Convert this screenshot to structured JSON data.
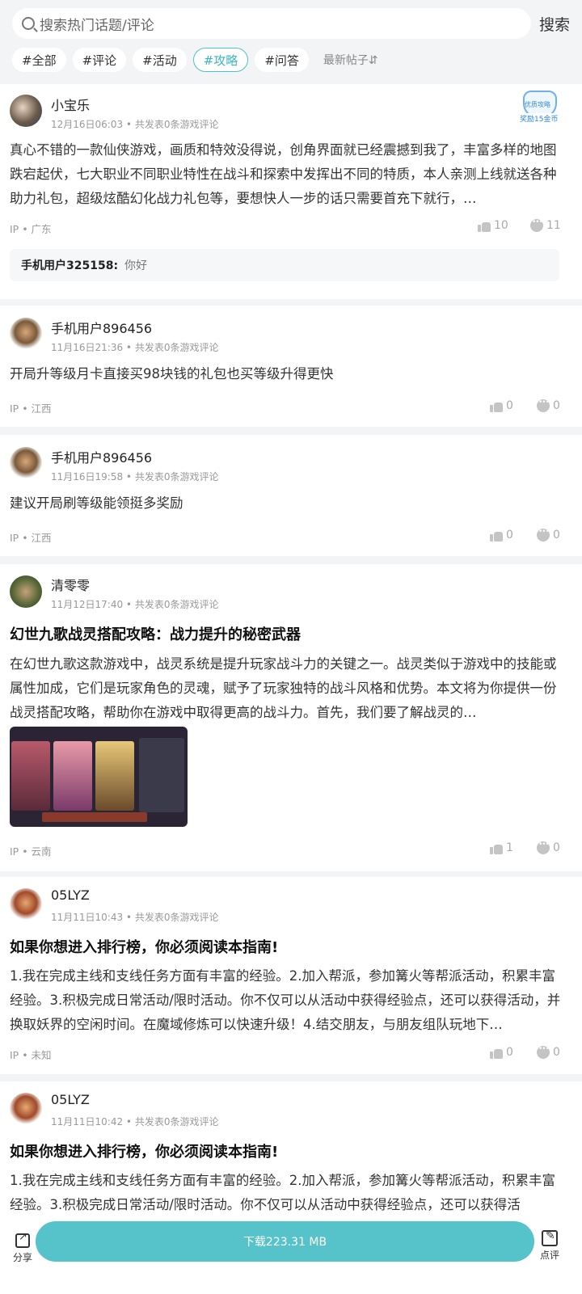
{
  "search": {
    "placeholder": "搜索热门话题/评论",
    "button": "搜索"
  },
  "tags": [
    "#全部",
    "#评论",
    "#活动",
    "#攻略",
    "#问答"
  ],
  "active_tag_index": 3,
  "sort_label": "最新帖子⇵",
  "posts": [
    {
      "user": "小宝乐",
      "meta": "12月16日06:03 • 共发表0条游戏评论",
      "body": "真心不错的一款仙侠游戏，画质和特效没得说，创角界面就已经震撼到我了，丰富多样的地图跌宕起伏，七大职业不同职业特性在战斗和探索中发挥出不同的特质，本人亲测上线就送各种助力礼包，超级炫酷幻化战力礼包等，要想快人一步的话只需要首充下就行，…",
      "ip": "IP • 广东",
      "likes": "10",
      "comments": "11",
      "badge_title": "优质攻略",
      "badge_reward": "奖励15金币",
      "reply_user": "手机用户325158:",
      "reply_text": "你好"
    },
    {
      "user": "手机用户896456",
      "meta": "11月16日21:36 • 共发表0条游戏评论",
      "body": "开局升等级月卡直接买98块钱的礼包也买等级升得更快",
      "ip": "IP • 江西",
      "likes": "0",
      "comments": "0"
    },
    {
      "user": "手机用户896456",
      "meta": "11月16日19:58 • 共发表0条游戏评论",
      "body": "建议开局刷等级能领挺多奖励",
      "ip": "IP • 江西",
      "likes": "0",
      "comments": "0"
    },
    {
      "user": "清零零",
      "meta": "11月12日17:40 • 共发表0条游戏评论",
      "title": "幻世九歌战灵搭配攻略：战力提升的秘密武器",
      "body": "在幻世九歌这款游戏中，战灵系统是提升玩家战斗力的关键之一。战灵类似于游戏中的技能或属性加成，它们是玩家角色的灵魂，赋予了玩家独特的战斗风格和优势。本文将为你提供一份战灵搭配攻略，帮助你在游戏中取得更高的战斗力。首先，我们要了解战灵的…",
      "ip": "IP • 云南",
      "likes": "1",
      "comments": "0"
    },
    {
      "user": "05LYZ",
      "meta": "11月11日10:43 • 共发表0条游戏评论",
      "title": "如果你想进入排行榜，你必须阅读本指南!",
      "body": "1.我在完成主线和支线任务方面有丰富的经验。2.加入帮派，参加篝火等帮派活动，积累丰富经验。3.积极完成日常活动/限时活动。你不仅可以从活动中获得经验点，还可以获得活动，并换取妖界的空闲时间。在魔域修炼可以快速升级！4.结交朋友，与朋友组队玩地下…",
      "ip": "IP • 未知",
      "likes": "0",
      "comments": "0"
    },
    {
      "user": "05LYZ",
      "meta": "11月11日10:42 • 共发表0条游戏评论",
      "title": "如果你想进入排行榜，你必须阅读本指南!",
      "body": "1.我在完成主线和支线任务方面有丰富的经验。2.加入帮派，参加篝火等帮派活动，积累丰富经验。3.积极完成日常活动/限时活动。你不仅可以从活动中获得经验点，还可以获得活"
    }
  ],
  "bottom": {
    "share": "分享",
    "download": "下载223.31 MB",
    "review": "点评"
  }
}
